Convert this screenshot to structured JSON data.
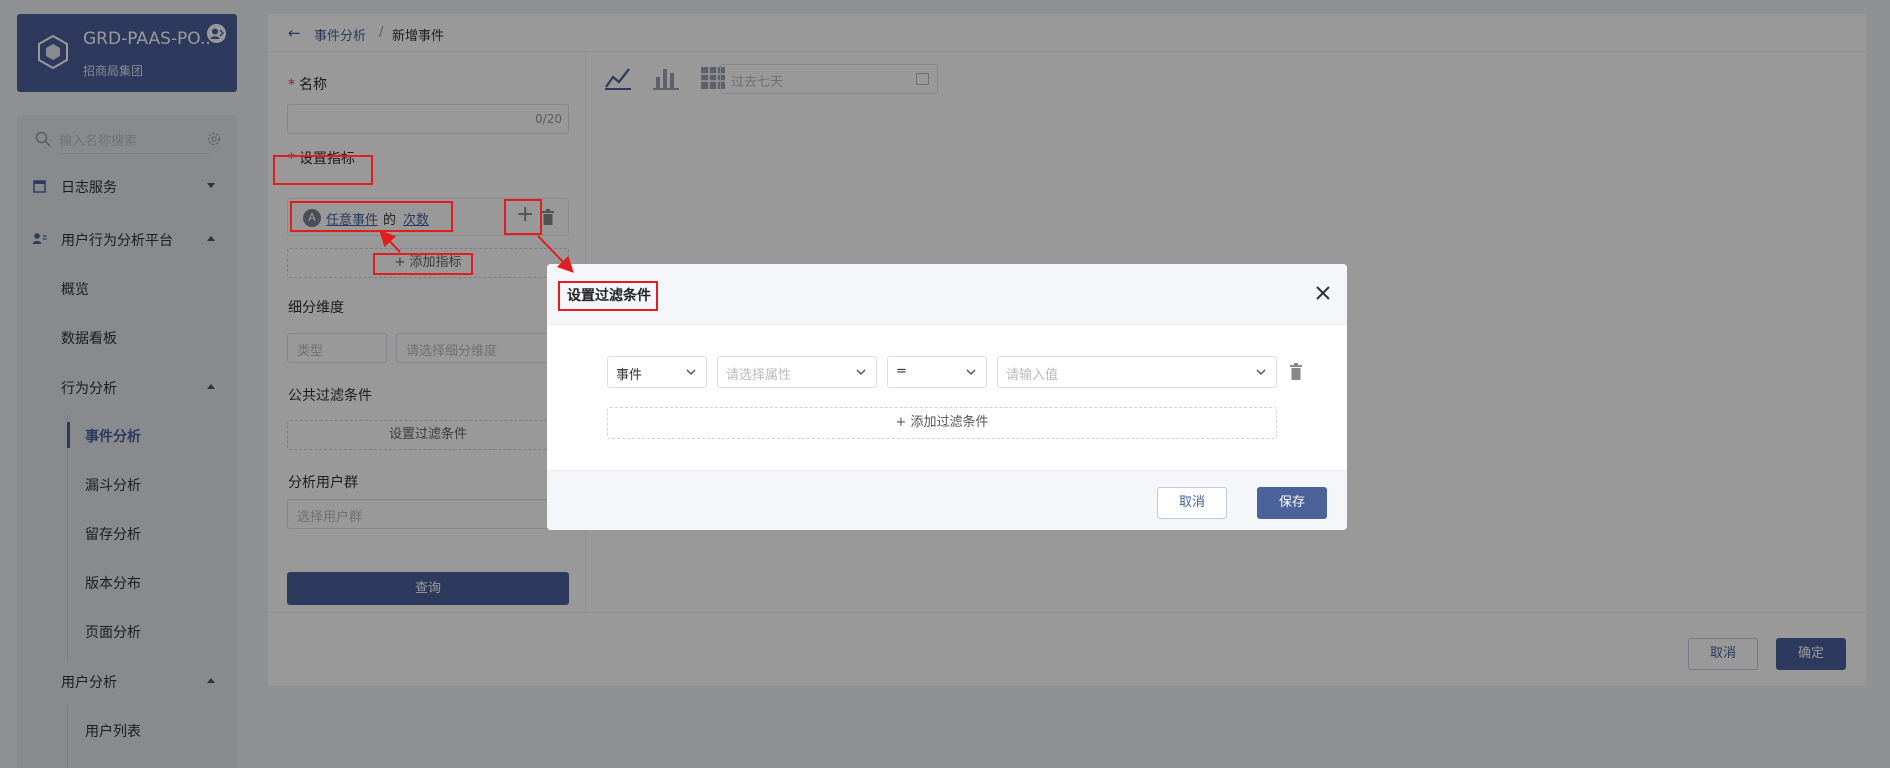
{
  "brand": {
    "title": "GRD-PAAS-PO...",
    "subtitle": "招商局集团"
  },
  "sidebar": {
    "search_placeholder": "输入名称搜索",
    "items": [
      {
        "label": "日志服务"
      },
      {
        "label": "用户行为分析平台"
      },
      {
        "label": "概览"
      },
      {
        "label": "数据看板"
      },
      {
        "label": "行为分析"
      },
      {
        "label": "事件分析"
      },
      {
        "label": "漏斗分析"
      },
      {
        "label": "留存分析"
      },
      {
        "label": "版本分布"
      },
      {
        "label": "页面分析"
      },
      {
        "label": "用户分析"
      },
      {
        "label": "用户列表"
      }
    ],
    "active_item": "事件分析"
  },
  "breadcrumb": {
    "back": "←",
    "parent": "事件分析",
    "separator": "/",
    "current": "新增事件"
  },
  "form": {
    "name_label": "名称",
    "name_count": "0/20",
    "required_mark": "*",
    "metric_label": "设置指标",
    "metric": {
      "letter": "A",
      "event": "任意事件",
      "of": "的",
      "measure": "次数",
      "add_icon": "+"
    },
    "add_metric": "+ 添加指标",
    "dimension_label": "细分维度",
    "type_placeholder": "类型",
    "dimension_placeholder": "请选择细分维度",
    "public_filter_label": "公共过滤条件",
    "set_filter_button": "设置过滤条件",
    "user_group_label": "分析用户群",
    "user_group_placeholder": "选择用户群",
    "query_button": "查询"
  },
  "chart_panel": {
    "date_placeholder": "过去七天",
    "chart_types": [
      "line-chart-icon",
      "bar-chart-icon",
      "table-icon"
    ]
  },
  "footer": {
    "cancel": "取消",
    "confirm": "确定"
  },
  "modal": {
    "title": "设置过滤条件",
    "close_icon": "close-icon",
    "row": {
      "field": "事件",
      "attribute_placeholder": "请选择属性",
      "operator": "=",
      "value_placeholder": "请输入值"
    },
    "add_condition": "+ 添加过滤条件",
    "cancel": "取消",
    "save": "保存"
  },
  "colors": {
    "accent": "#4b629b",
    "required": "#e23c3c",
    "annotation": "#e21d1d"
  }
}
